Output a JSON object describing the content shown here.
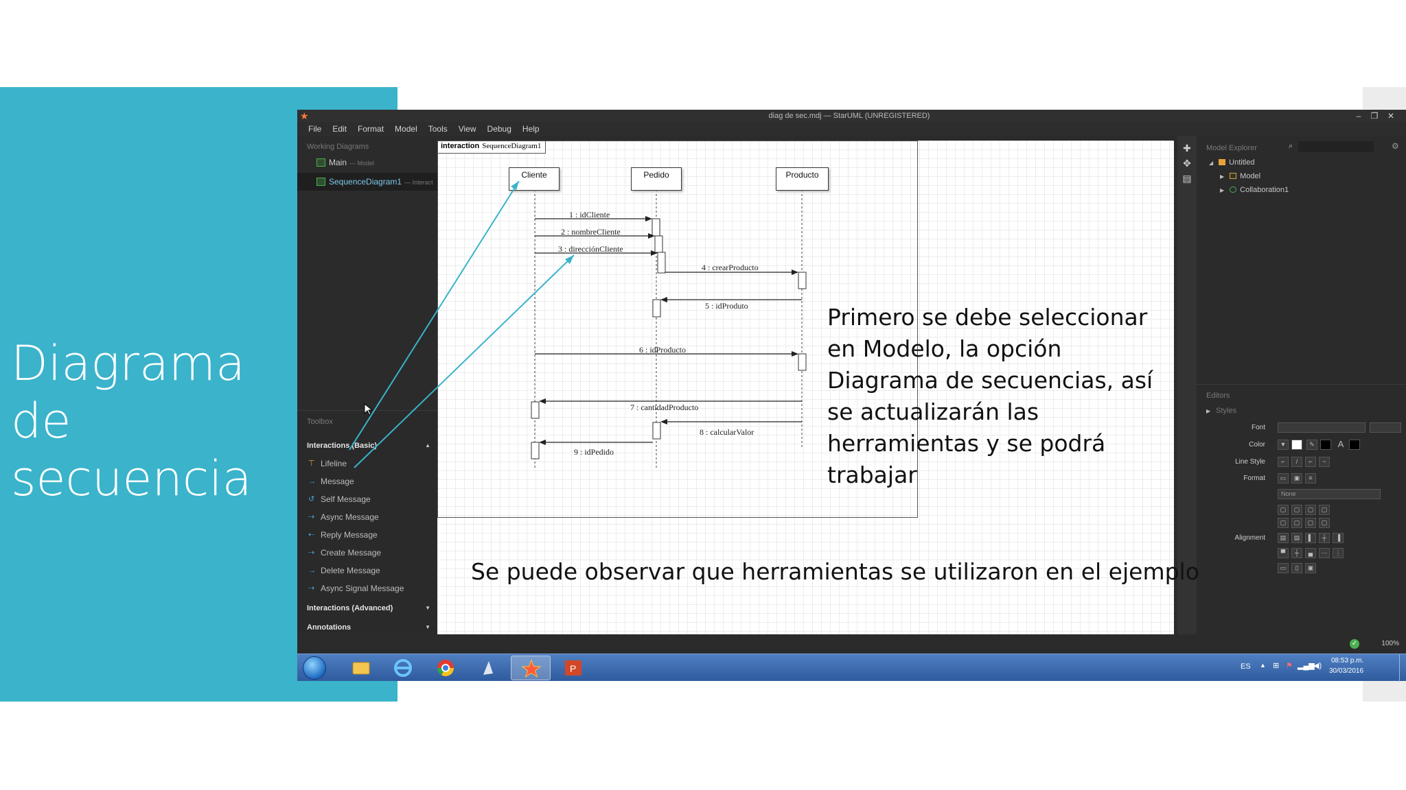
{
  "slide": {
    "title_line1": "Diagrama de",
    "title_line2": "secuencia",
    "note_main": "Primero se debe seleccionar en Modelo, la opción Diagrama de secuencias, así se actualizarán las herramientas y se podrá trabajar",
    "note_bottom": "Se puede observar que herramientas se utilizaron en el ejemplo"
  },
  "window": {
    "title": "diag de sec.mdj — StarUML (UNREGISTERED)",
    "controls": [
      "–",
      "❐",
      "✕"
    ]
  },
  "menu": [
    "File",
    "Edit",
    "Format",
    "Model",
    "Tools",
    "View",
    "Debug",
    "Help"
  ],
  "working_diagrams": {
    "header": "Working Diagrams",
    "items": [
      {
        "label": "Main",
        "sub": "— Model"
      },
      {
        "label": "SequenceDiagram1",
        "sub": "— Interact"
      }
    ]
  },
  "toolbox": {
    "header": "Toolbox",
    "group_basic": "Interactions (Basic)",
    "items": [
      "Lifeline",
      "Message",
      "Self Message",
      "Async Message",
      "Reply Message",
      "Create Message",
      "Delete Message",
      "Async Signal Message"
    ],
    "group_advanced": "Interactions (Advanced)",
    "group_annotations": "Annotations"
  },
  "diagram": {
    "frame_keyword": "interaction",
    "frame_name": "SequenceDiagram1",
    "lifelines": [
      "Cliente",
      "Pedido",
      "Producto"
    ],
    "messages": [
      "1 : idCliente",
      "2 : nombreCliente",
      "3 : direcciónCliente",
      "4 : crearProducto",
      "5 : idProduto",
      "6 : idProducto",
      "7 : cantidadProducto",
      "8 : calcularValor",
      "9 : idPedido"
    ]
  },
  "model_explorer": {
    "header": "Model Explorer",
    "tree": [
      "Untitled",
      "Model",
      "Collaboration1"
    ]
  },
  "editors": {
    "header": "Editors",
    "styles": "Styles",
    "font_label": "Font",
    "color_label": "Color",
    "line_style_label": "Line Style",
    "format_label": "Format",
    "format_value": "None",
    "alignment_label": "Alignment"
  },
  "status": {
    "zoom": "100%"
  },
  "taskbar": {
    "language": "ES",
    "time": "08:53 p.m.",
    "date": "30/03/2016"
  },
  "colors": {
    "teal": "#3ab3cb",
    "app_bg": "#2b2b2b",
    "annotation_line": "#3ab3cb",
    "selected_text": "#7dc9e8"
  }
}
